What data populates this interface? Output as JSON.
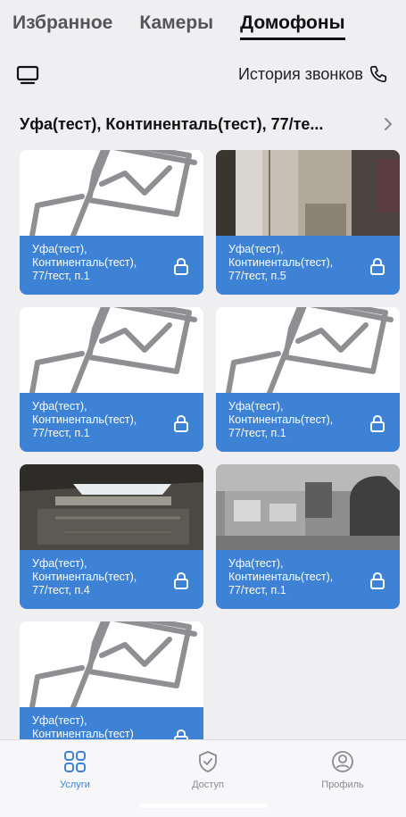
{
  "tabs": [
    {
      "label": "Избранное"
    },
    {
      "label": "Камеры"
    },
    {
      "label": "Домофоны",
      "active": true
    }
  ],
  "toolbar": {
    "display_icon": "monitor-icon",
    "history_label": "История звонков",
    "history_icon": "phone-icon"
  },
  "address": {
    "label": "Уфа(тест), Континенталь(тест), 77/те...",
    "icon": "chevron-right-icon"
  },
  "cards": [
    {
      "line1": "Уфа(тест),",
      "line2": "Континенталь(тест),",
      "line3": "77/тест, п.1",
      "thumb": "placeholder"
    },
    {
      "line1": "Уфа(тест),",
      "line2": "Континенталь(тест),",
      "line3": "77/тест, п.5",
      "thumb": "camera-wall"
    },
    {
      "line1": "Уфа(тест),",
      "line2": "Континенталь(тест),",
      "line3": "77/тест, п.1",
      "thumb": "placeholder"
    },
    {
      "line1": "Уфа(тест),",
      "line2": "Континенталь(тест),",
      "line3": "77/тест, п.1",
      "thumb": "placeholder"
    },
    {
      "line1": "Уфа(тест),",
      "line2": "Континенталь(тест),",
      "line3": "77/тест, п.4",
      "thumb": "camera-ceiling"
    },
    {
      "line1": "Уфа(тест),",
      "line2": "Континенталь(тест),",
      "line3": "77/тест, п.1",
      "thumb": "camera-office"
    },
    {
      "line1": "Уфа(тест),",
      "line2": "Континенталь(тест)",
      "line3": "",
      "thumb": "placeholder"
    }
  ],
  "colors": {
    "accent": "#3d82d4",
    "background": "#efeff2"
  },
  "nav": [
    {
      "label": "Услуги",
      "icon": "services-icon",
      "active": true
    },
    {
      "label": "Доступ",
      "icon": "shield-check-icon"
    },
    {
      "label": "Профиль",
      "icon": "profile-icon"
    }
  ]
}
